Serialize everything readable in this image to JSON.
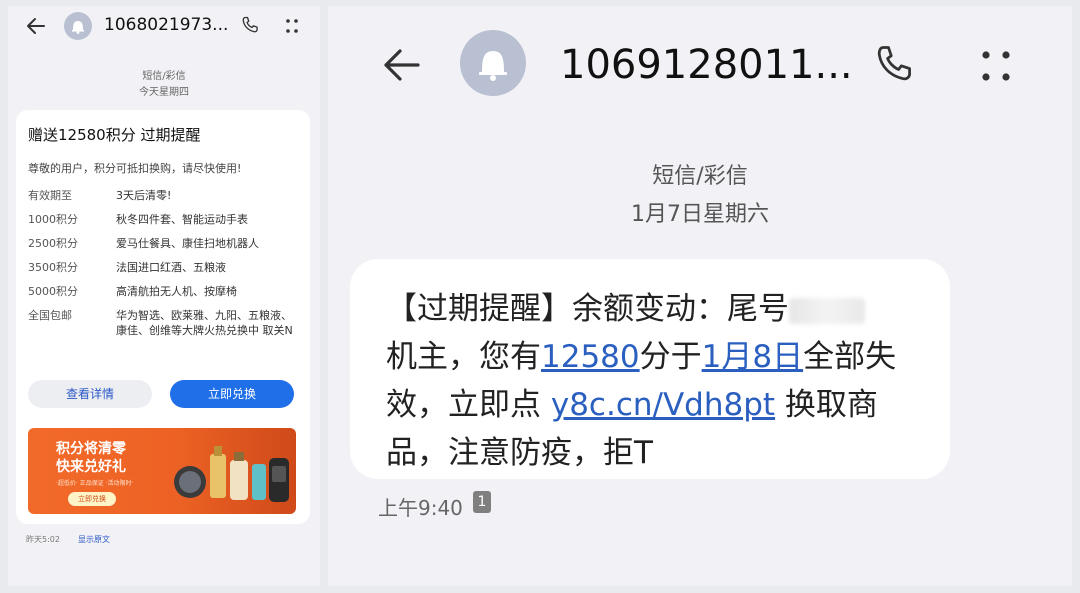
{
  "left": {
    "header": {
      "number": "1068021973...",
      "icons": [
        "back-arrow-icon",
        "avatar-bell-icon",
        "phone-icon",
        "more-icon"
      ]
    },
    "channel": "短信/彩信",
    "date": "今天星期四",
    "card": {
      "title": "赠送12580积分 过期提醒",
      "intro": "尊敬的用户，积分可抵扣换购，请尽快使用!",
      "rows": [
        {
          "key": "有效期至",
          "value": "3天后清零!"
        },
        {
          "key": "1000积分",
          "value": "秋冬四件套、智能运动手表"
        },
        {
          "key": "2500积分",
          "value": "爱马仕餐具、康佳扫地机器人"
        },
        {
          "key": "3500积分",
          "value": "法国进口红酒、五粮液"
        },
        {
          "key": "5000积分",
          "value": "高清航拍无人机、按摩椅"
        },
        {
          "key": "全国包邮",
          "value": "华为智选、欧莱雅、九阳、五粮液、康佳、创维等大牌火热兑换中 取关N"
        }
      ],
      "buttons": {
        "details": "查看详情",
        "redeem": "立即兑换"
      },
      "banner": {
        "line1": "积分将清零",
        "line2": "快来兑好礼",
        "small": "·超低价· 正品保证 ·活动限时·",
        "button": "立即兑换"
      }
    },
    "footer": {
      "time": "昨天5:02",
      "link": "显示原文"
    }
  },
  "right": {
    "header": {
      "number": "1069128011...",
      "icons": [
        "back-arrow-icon",
        "avatar-bell-icon",
        "phone-icon",
        "more-icon"
      ]
    },
    "channel": "短信/彩信",
    "date": "1月7日星期六",
    "message": {
      "line1": "【过期提醒】余额变动：尾号",
      "line2_a": "机主，您有",
      "line2_link1": "12580",
      "line2_b": "分于",
      "line2_link2": "1月8日",
      "line2_c": "全部失",
      "line3_a": "效，立即点 ",
      "line3_link": "y8c.cn/Vdh8pt",
      "line3_b": " 换取商",
      "line4": "品，注意防疫，拒T"
    },
    "time": "上午9:40",
    "sim": "1"
  },
  "colors": {
    "link": "#2a5fc0",
    "primary_button": "#1f6fe8",
    "banner": "#ed6224"
  }
}
